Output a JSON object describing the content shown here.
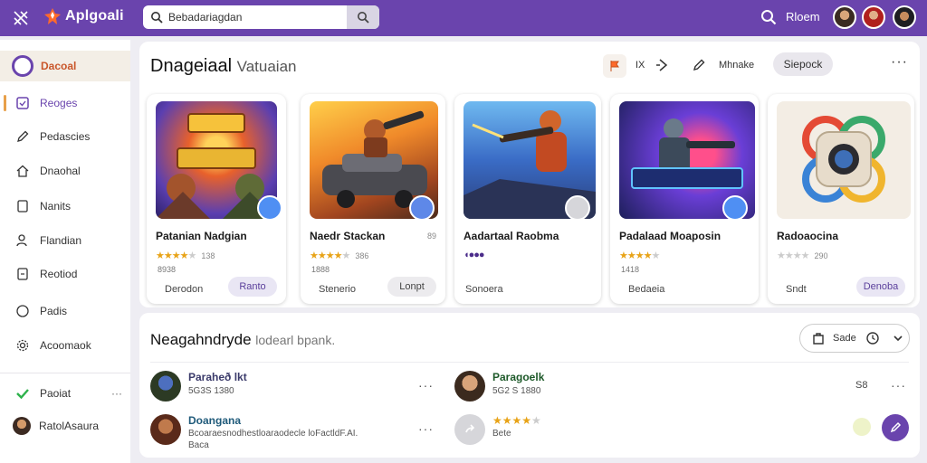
{
  "app": {
    "name": "Aplgoali"
  },
  "search": {
    "value": "Bebadariagdan"
  },
  "topbar": {
    "user_label": "Rloem"
  },
  "sidebar": {
    "active": "Dacoal",
    "items": [
      {
        "label": "Reoges",
        "icon": "square-icon"
      },
      {
        "label": "Pedascies",
        "icon": "pen-icon"
      },
      {
        "label": "Dnaohal",
        "icon": "home-icon"
      },
      {
        "label": "Nanits",
        "icon": "doc-icon"
      },
      {
        "label": "Flandian",
        "icon": "users-icon"
      },
      {
        "label": "Reotiod",
        "icon": "doc-icon"
      },
      {
        "label": "Padis",
        "icon": "circle-icon"
      },
      {
        "label": "Acoomaok",
        "icon": "gear-icon"
      }
    ],
    "bottom": [
      {
        "label": "Paoiat",
        "more": "···"
      },
      {
        "label": "RatolAsaura"
      }
    ]
  },
  "featured": {
    "title": "Dnageiaal",
    "subtitle": "Vatuaian",
    "tools": {
      "tag": "IX",
      "share_label": "Mhnake",
      "sort_label": "Siepock",
      "more": "···"
    },
    "cards": [
      {
        "title": "Patanian Nadgian",
        "tag": "",
        "stars_full": 4,
        "stars_empty": 1,
        "rating_count": "138",
        "sub": "8938",
        "foot": "Derodon",
        "button": "Ranto"
      },
      {
        "title": "Naedr Stackan",
        "tag": "89",
        "stars_full": 4,
        "stars_empty": 1,
        "rating_count": "386",
        "sub": "1888",
        "foot": "Stenerio",
        "button": "Lonpt"
      },
      {
        "title": "Aadartaal Raobma",
        "tag": "",
        "stars_full": 0,
        "stars_empty": 0,
        "rating_count": "",
        "sub": "",
        "foot": "Sonoera",
        "button": ""
      },
      {
        "title": "Padalaad Moaposin",
        "tag": "",
        "stars_full": 4,
        "stars_empty": 1,
        "rating_count": "",
        "sub": "1418",
        "foot": "Bedaeia",
        "button": ""
      },
      {
        "title": "Radoaocina",
        "tag": "",
        "stars_full": 0,
        "stars_empty": 4,
        "rating_count": "290",
        "sub": "",
        "foot": "Sndt",
        "button": "Denoba"
      }
    ]
  },
  "recent": {
    "title": "Neagahndryde",
    "subtitle": "lodearl bpank.",
    "sort_label": "Sade",
    "count": "S8",
    "rows": [
      {
        "name": "Paraheð lkt",
        "stat": "5G3S 1380",
        "meta": ""
      },
      {
        "name": "Paragoelk",
        "stat": "5G2 S 1880",
        "meta": ""
      },
      {
        "name": "Doangana",
        "stat": "Bcoaraesnodhestloaraodecle loFactldF.AI.",
        "meta": "Baca"
      },
      {
        "name": "",
        "stat": "",
        "meta": "Bete",
        "stars_full": 4,
        "stars_empty": 1
      }
    ]
  },
  "colors": {
    "accent": "#6a44ad",
    "star": "#e8a317"
  }
}
